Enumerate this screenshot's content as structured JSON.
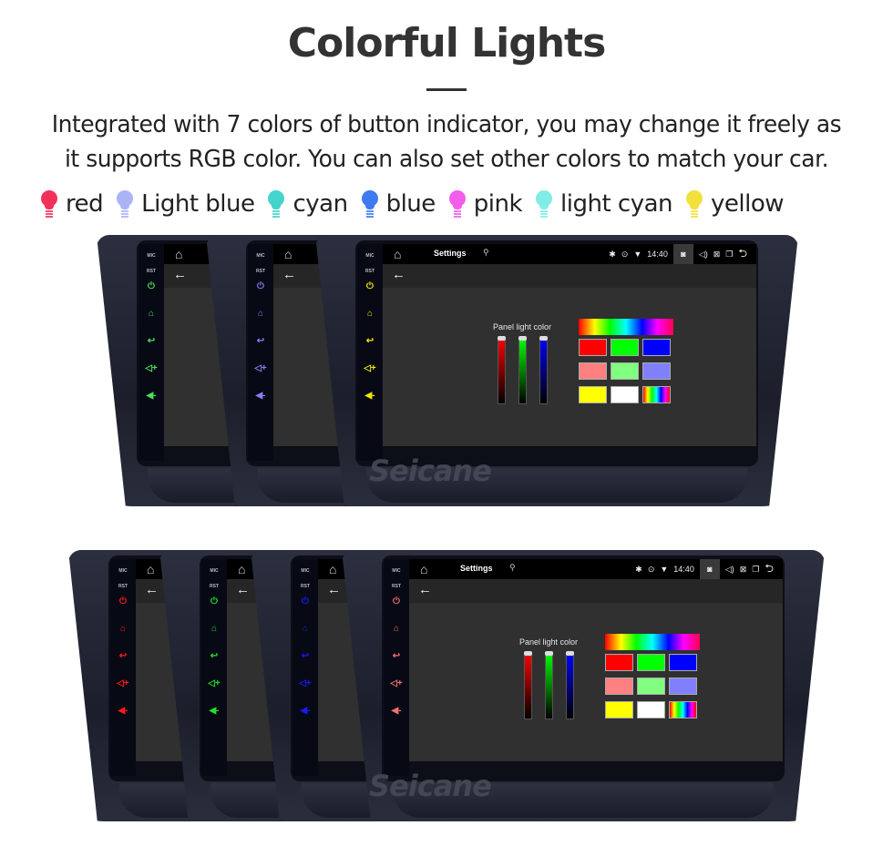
{
  "header": {
    "title": "Colorful Lights",
    "description_line1": "Integrated with 7 colors of button indicator, you may change it freely as",
    "description_line2": "it supports RGB color. You can also set other colors to match your car."
  },
  "legend": [
    {
      "label": "red",
      "color": "#f2315a",
      "icon": "lightbulb-icon"
    },
    {
      "label": "Light blue",
      "color": "#a9b4f7",
      "icon": "lightbulb-icon"
    },
    {
      "label": "cyan",
      "color": "#45d3cd",
      "icon": "lightbulb-icon"
    },
    {
      "label": "blue",
      "color": "#3f7bee",
      "icon": "lightbulb-icon"
    },
    {
      "label": "pink",
      "color": "#f25ee9",
      "icon": "lightbulb-icon"
    },
    {
      "label": "light cyan",
      "color": "#82ede5",
      "icon": "lightbulb-icon"
    },
    {
      "label": "yellow",
      "color": "#f2e03c",
      "icon": "lightbulb-icon"
    }
  ],
  "head_unit": {
    "side_labels": {
      "mic": "MIC",
      "rst": "RST"
    },
    "side_icons": [
      "power-icon",
      "home-icon",
      "back-icon",
      "volume-up-icon",
      "volume-down-icon"
    ],
    "side_glyphs": [
      "⏻",
      "⌂",
      "↩",
      "◁+",
      "◀-"
    ],
    "statusbar": {
      "title": "Settings",
      "usb_glyph": "⚲",
      "bluetooth_glyph": "✱",
      "location_glyph": "⊙",
      "wifi_glyph": "▼",
      "time": "14:40",
      "camera_glyph": "◙",
      "volume_glyph": "◁)",
      "close_glyph": "⊠",
      "recents_glyph": "❐",
      "back_glyph": "⮌",
      "home_glyph": "⌂"
    },
    "actionbar_back_glyph": "←",
    "panel_light_color_label": "Panel light color",
    "sliders": [
      {
        "name": "red",
        "color": "#ff0000"
      },
      {
        "name": "green",
        "color": "#00ff00"
      },
      {
        "name": "blue",
        "color": "#0000ff"
      }
    ],
    "swatches": [
      [
        "#ff0000",
        "#00ff00",
        "#0000ff"
      ],
      [
        "#ff8080",
        "#80ff80",
        "#8080ff"
      ],
      [
        "#ffff00",
        "#ffffff",
        "rainbow"
      ]
    ],
    "brand": "Seicane"
  },
  "rows": [
    {
      "units": [
        {
          "indicator_color": "#4de05a",
          "full": false
        },
        {
          "indicator_color": "#8a7cff",
          "full": false
        },
        {
          "indicator_color": "#f0e800",
          "full": true
        }
      ]
    },
    {
      "units": [
        {
          "indicator_color": "#ff1a1a",
          "full": false
        },
        {
          "indicator_color": "#22e02a",
          "full": false
        },
        {
          "indicator_color": "#1a1aff",
          "full": false
        },
        {
          "indicator_color": "#f07070",
          "full": true
        }
      ]
    }
  ]
}
